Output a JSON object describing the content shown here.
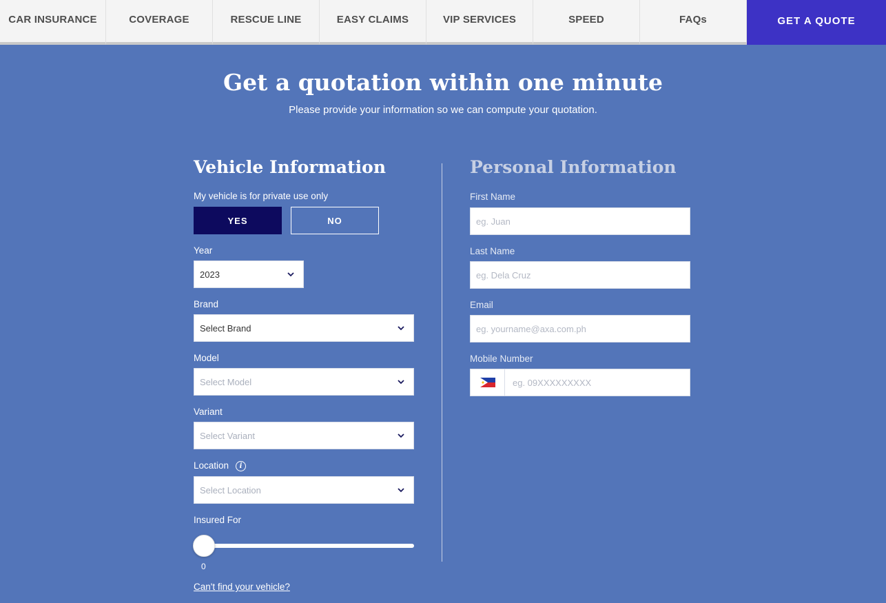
{
  "nav": {
    "items": [
      {
        "label": "CAR INSURANCE"
      },
      {
        "label": "COVERAGE"
      },
      {
        "label": "RESCUE LINE"
      },
      {
        "label": "EASY CLAIMS"
      },
      {
        "label": "VIP SERVICES"
      },
      {
        "label": "SPEED"
      },
      {
        "label": "FAQs"
      }
    ],
    "cta": "GET A QUOTE"
  },
  "hero": {
    "title": "Get a quotation within one minute",
    "subtitle": "Please provide your information so we can compute your quotation."
  },
  "vehicle": {
    "title": "Vehicle Information",
    "private_use_label": "My vehicle is for private use only",
    "yes_label": "YES",
    "no_label": "NO",
    "year_label": "Year",
    "year_value": "2023",
    "brand_label": "Brand",
    "brand_value": "Select Brand",
    "model_label": "Model",
    "model_placeholder": "Select Model",
    "variant_label": "Variant",
    "variant_placeholder": "Select Variant",
    "location_label": "Location",
    "location_placeholder": "Select Location",
    "insured_label": "Insured For",
    "insured_value": "0",
    "cant_find_link": "Can't find your vehicle?"
  },
  "personal": {
    "title": "Personal Information",
    "first_name_label": "First Name",
    "first_name_placeholder": "eg. Juan",
    "last_name_label": "Last Name",
    "last_name_placeholder": "eg. Dela Cruz",
    "email_label": "Email",
    "email_placeholder": "eg. yourname@axa.com.ph",
    "mobile_label": "Mobile Number",
    "mobile_placeholder": "eg. 09XXXXXXXXX"
  },
  "colors": {
    "background": "#5375b9",
    "cta": "#3d32c5",
    "yes_active": "#0d0a5e"
  }
}
